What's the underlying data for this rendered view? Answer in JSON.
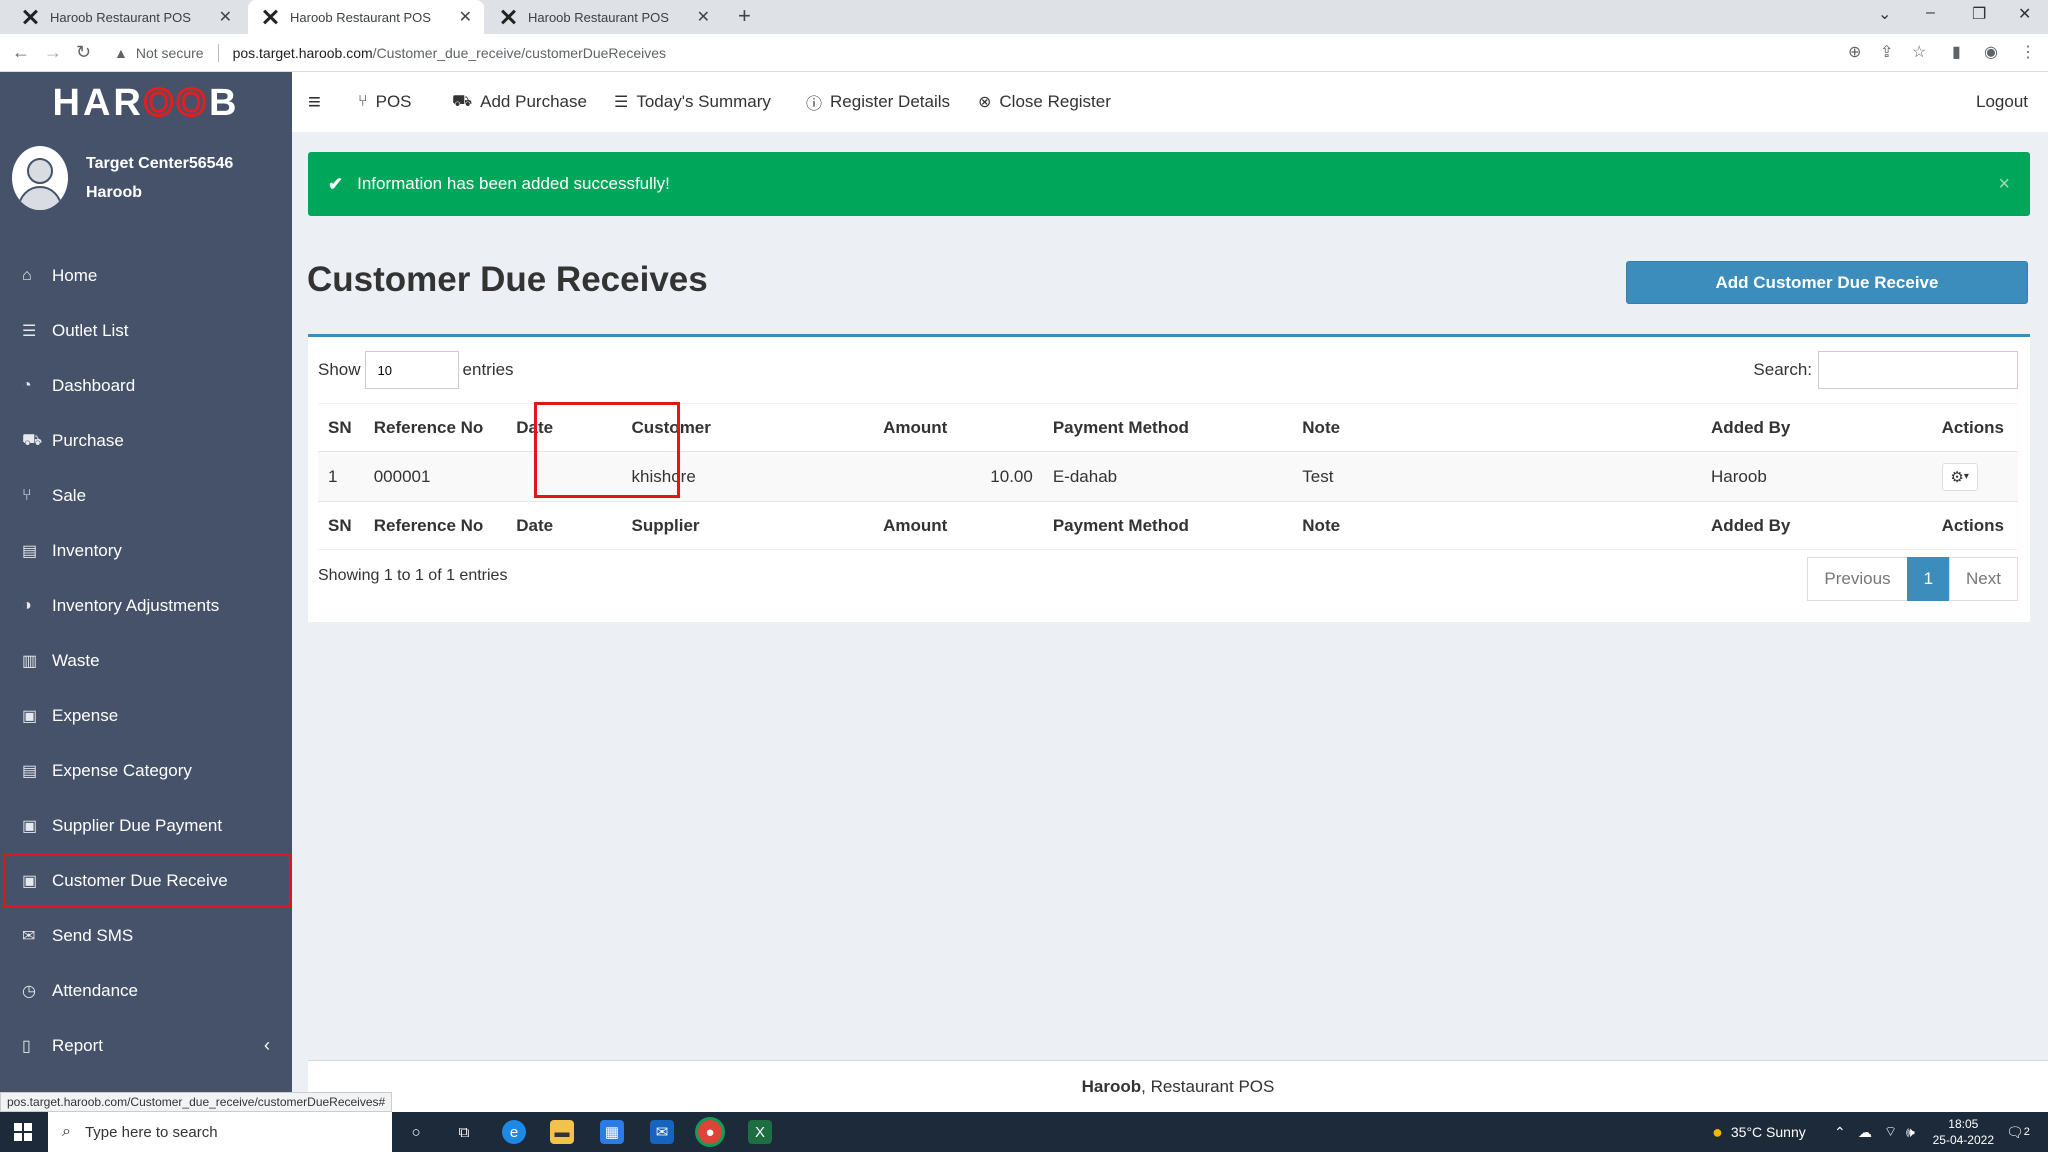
{
  "browser": {
    "tabs": [
      {
        "title": "Haroob Restaurant POS",
        "active": false
      },
      {
        "title": "Haroob Restaurant POS",
        "active": true
      },
      {
        "title": "Haroob Restaurant POS",
        "active": false
      }
    ],
    "security": "Not secure",
    "url_host": "pos.target.haroob.com",
    "url_path": "/Customer_due_receive/customerDueReceives",
    "status_url": "pos.target.haroob.com/Customer_due_receive/customerDueReceives#"
  },
  "sidebar": {
    "logo": {
      "part1": "HAR",
      "part2": "OO",
      "part3": "B"
    },
    "user": {
      "line1": "Target Center56546",
      "line2": "Haroob"
    },
    "items": [
      {
        "label": "Home",
        "icon": "home-icon",
        "glyph": "⌂"
      },
      {
        "label": "Outlet List",
        "icon": "list-icon",
        "glyph": "☰"
      },
      {
        "label": "Dashboard",
        "icon": "dashboard-icon",
        "glyph": "◔"
      },
      {
        "label": "Purchase",
        "icon": "truck-icon",
        "glyph": "⛟"
      },
      {
        "label": "Sale",
        "icon": "cutlery-icon",
        "glyph": "⑂"
      },
      {
        "label": "Inventory",
        "icon": "inbox-icon",
        "glyph": "▤"
      },
      {
        "label": "Inventory Adjustments",
        "icon": "adjust-icon",
        "glyph": "◑"
      },
      {
        "label": "Waste",
        "icon": "trash-icon",
        "glyph": "▥"
      },
      {
        "label": "Expense",
        "icon": "money-icon",
        "glyph": "▣"
      },
      {
        "label": "Expense Category",
        "icon": "list-alt-icon",
        "glyph": "▤"
      },
      {
        "label": "Supplier Due Payment",
        "icon": "money-icon",
        "glyph": "▣"
      },
      {
        "label": "Customer Due Receive",
        "icon": "money-icon",
        "glyph": "▣"
      },
      {
        "label": "Send SMS",
        "icon": "envelope-icon",
        "glyph": "✉"
      },
      {
        "label": "Attendance",
        "icon": "clock-icon",
        "glyph": "◷"
      },
      {
        "label": "Report",
        "icon": "file-icon",
        "glyph": "▯"
      }
    ],
    "selected_index": 11
  },
  "topnav": {
    "menu_glyph": "≡",
    "items": [
      {
        "label": "POS",
        "glyph": "⑂"
      },
      {
        "label": "Add Purchase",
        "glyph": "⛟"
      },
      {
        "label": "Today's Summary",
        "glyph": "☰"
      },
      {
        "label": "Register Details",
        "glyph": "ⓘ"
      },
      {
        "label": "Close Register",
        "glyph": "⊗"
      }
    ],
    "logout": "Logout"
  },
  "alert": {
    "message": "Information has been added successfully!",
    "close": "×"
  },
  "page": {
    "title": "Customer Due Receives",
    "add_button": "Add Customer Due Receive"
  },
  "table": {
    "show_label": "Show",
    "entries_value": "10",
    "entries_label": "entries",
    "search_label": "Search:",
    "headers": [
      "SN",
      "Reference No",
      "Date",
      "Customer",
      "Amount",
      "Payment Method",
      "Note",
      "Added By",
      "Actions"
    ],
    "rows": [
      {
        "sn": "1",
        "ref": "000001",
        "date": "",
        "customer": "khishore",
        "amount": "10.00",
        "method": "E-dahab",
        "note": "Test",
        "added_by": "Haroob"
      }
    ],
    "footer_headers": [
      "SN",
      "Reference No",
      "Date",
      "Supplier",
      "Amount",
      "Payment Method",
      "Note",
      "Added By",
      "Actions"
    ],
    "info": "Showing 1 to 1 of 1 entries",
    "pagination": {
      "previous": "Previous",
      "current": "1",
      "next": "Next"
    }
  },
  "footer": {
    "brand": "Haroob",
    "rest": ", Restaurant POS"
  },
  "taskbar": {
    "search_placeholder": "Type here to search",
    "weather": "35°C  Sunny",
    "time": "18:05",
    "date": "25-04-2022",
    "notifications": "2"
  },
  "colors": {
    "sidebar": "#46526a",
    "primary": "#3c8dbc",
    "success": "#00a65a",
    "highlight": "#e0161c"
  }
}
